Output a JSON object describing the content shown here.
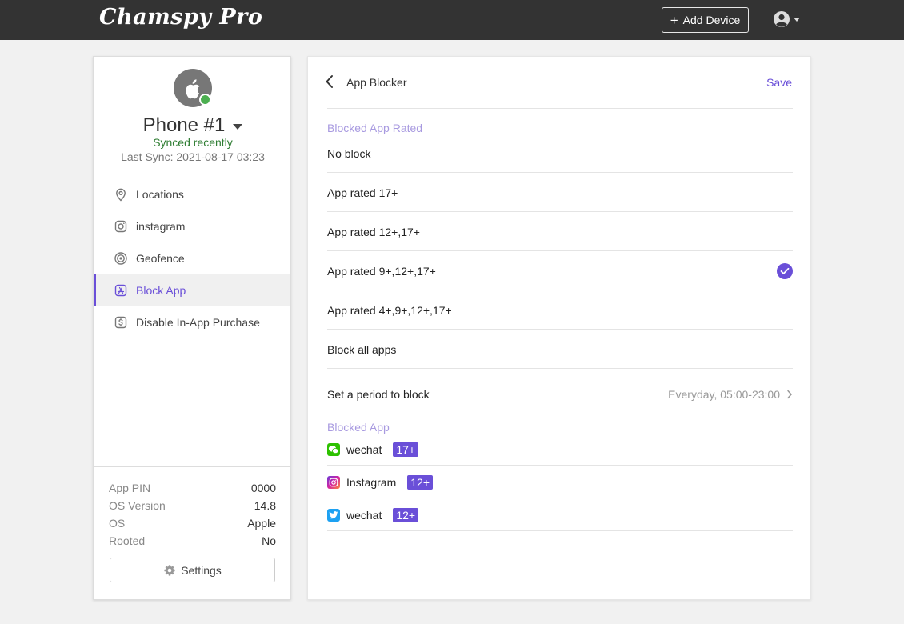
{
  "header": {
    "brand": "Chamspy Pro",
    "add_device_label": "Add Device"
  },
  "device": {
    "name": "Phone #1",
    "sync_status": "Synced recently",
    "last_sync": "Last Sync: 2021-08-17 03:23"
  },
  "sidebar": {
    "items": [
      {
        "label": "Locations",
        "icon": "location-pin-icon"
      },
      {
        "label": "instagram",
        "icon": "instagram-icon"
      },
      {
        "label": "Geofence",
        "icon": "geofence-icon"
      },
      {
        "label": "Block App",
        "icon": "app-store-icon",
        "active": true
      },
      {
        "label": "Disable In-App Purchase",
        "icon": "dollar-icon"
      }
    ]
  },
  "device_info": [
    {
      "key": "App PIN",
      "value": "0000"
    },
    {
      "key": "OS Version",
      "value": "14.8"
    },
    {
      "key": "OS",
      "value": "Apple"
    },
    {
      "key": "Rooted",
      "value": "No"
    }
  ],
  "settings_label": "Settings",
  "panel": {
    "title": "App Blocker",
    "save_label": "Save",
    "rated_section_label": "Blocked App Rated",
    "options": [
      {
        "label": "No block",
        "selected": false
      },
      {
        "label": "App rated 17+",
        "selected": false
      },
      {
        "label": "App rated 12+,17+",
        "selected": false
      },
      {
        "label": "App rated 9+,12+,17+",
        "selected": true
      },
      {
        "label": "App rated 4+,9+,12+,17+",
        "selected": false
      },
      {
        "label": "Block all apps",
        "selected": false
      }
    ],
    "period_label": "Set a period to block",
    "period_value": "Everyday, 05:00-23:00",
    "blocked_section_label": "Blocked App",
    "blocked_apps": [
      {
        "name": "wechat",
        "rating": "17+",
        "icon": "wechat-icon"
      },
      {
        "name": "Instagram",
        "rating": "12+",
        "icon": "instagram-icon"
      },
      {
        "name": "wechat",
        "rating": "12+",
        "icon": "twitter-icon"
      }
    ]
  },
  "colors": {
    "accent": "#6a4fd8",
    "topbar": "#333333",
    "online": "#4caf50",
    "synced_text": "#2e7d32"
  }
}
